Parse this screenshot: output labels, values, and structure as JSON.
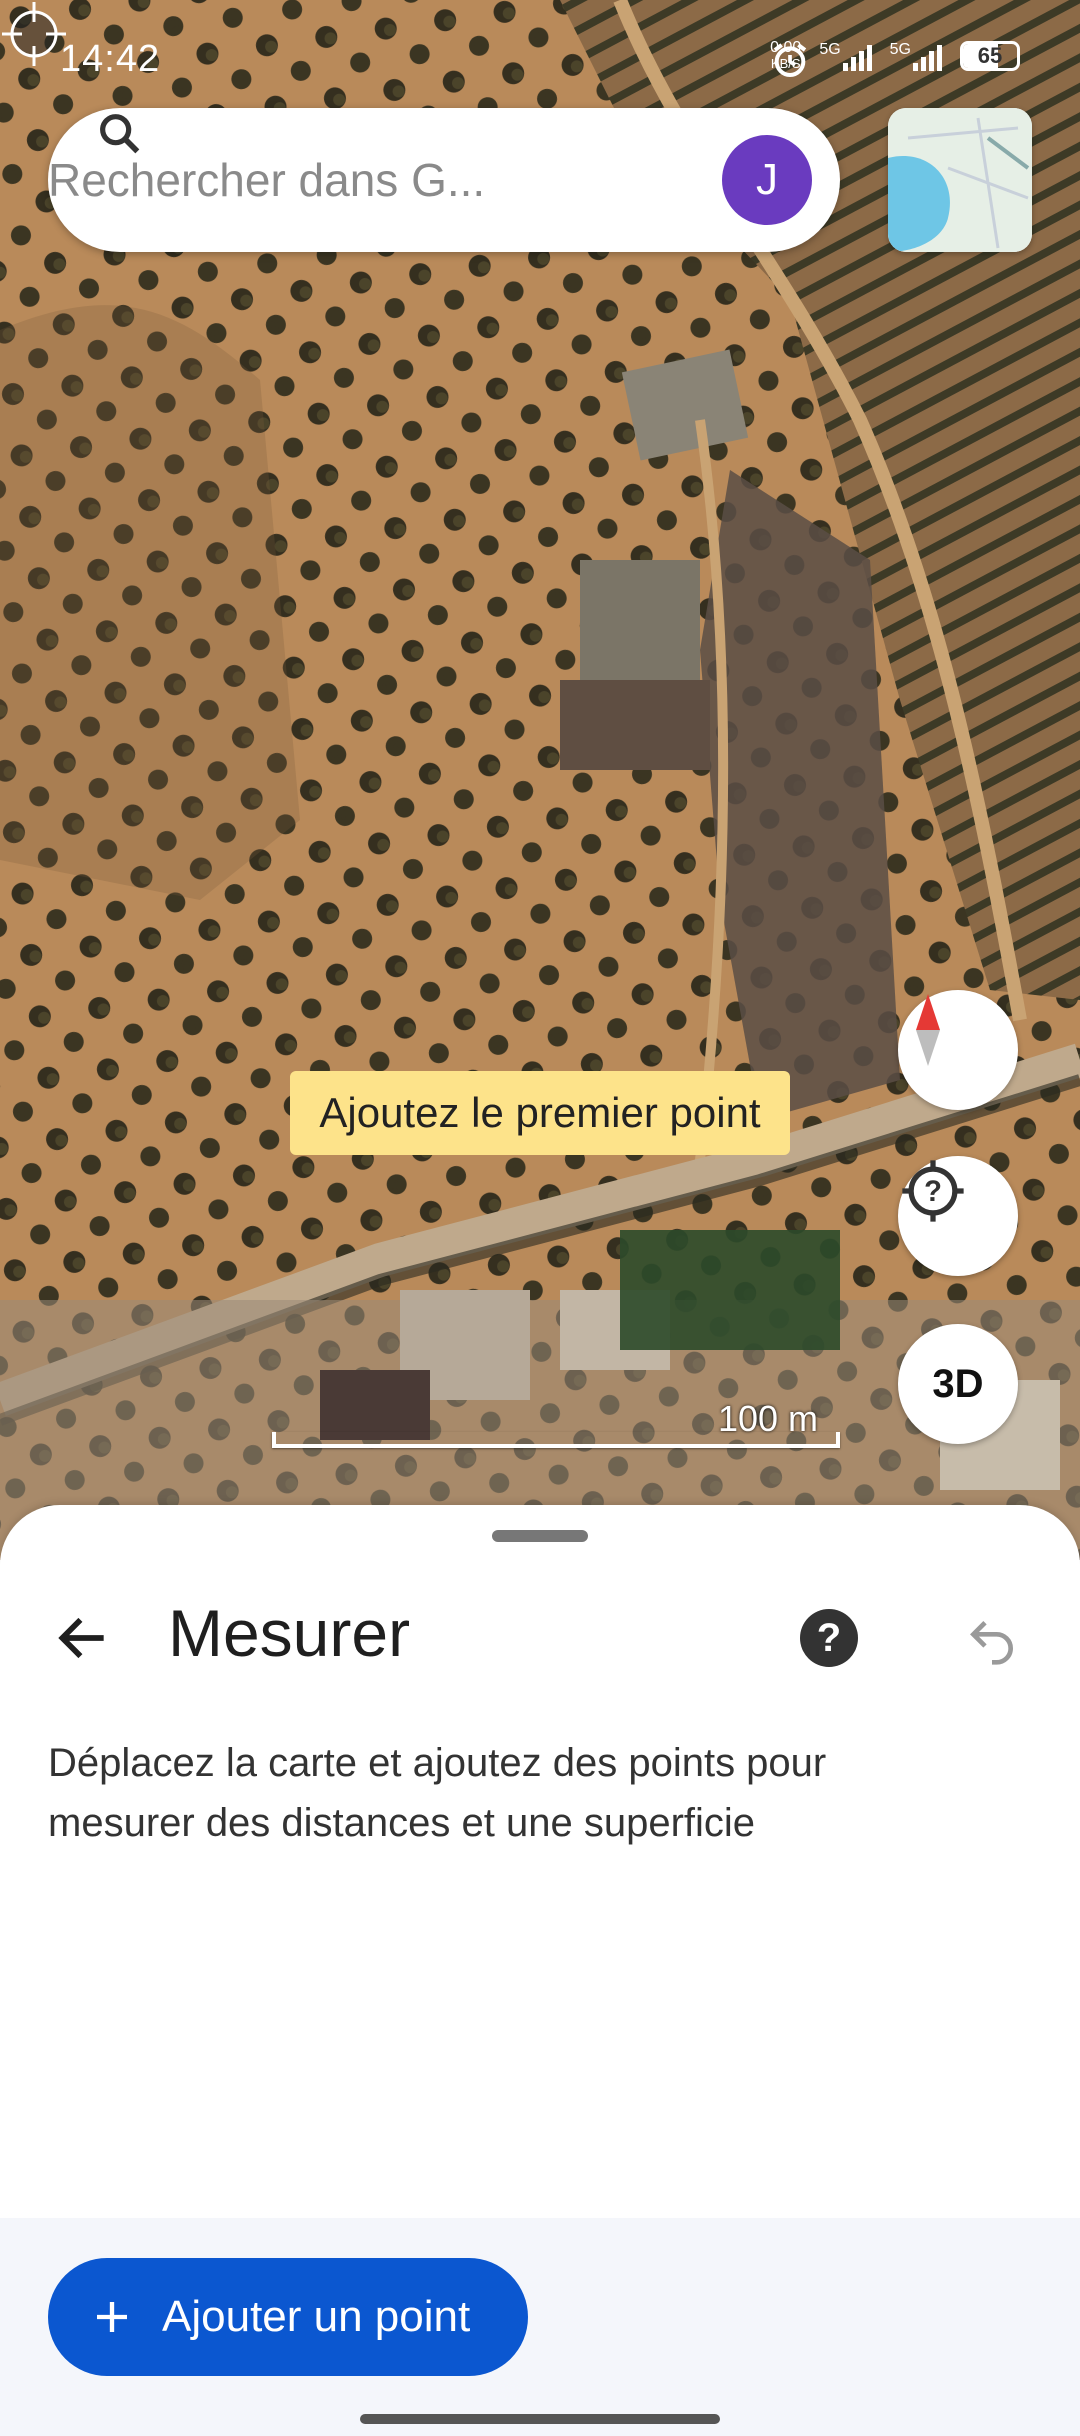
{
  "status_bar": {
    "time": "14:42",
    "net_speed": "0,00",
    "net_unit": "KB/S",
    "sim1": "5G",
    "sim2": "5G",
    "battery": "65"
  },
  "search": {
    "placeholder": "Rechercher dans G...",
    "avatar_letter": "J"
  },
  "map": {
    "hint": "Ajoutez le premier point",
    "scale_label": "100 m",
    "three_d_label": "3D"
  },
  "sheet": {
    "title": "Mesurer",
    "help_glyph": "?",
    "description": "Déplacez la carte et ajoutez des points pour mesurer des distances et une superficie",
    "add_button_label": "Ajouter un point"
  },
  "colors": {
    "accent": "#0b57d0",
    "hint_bg": "#fde38a",
    "avatar": "#6a3bbf"
  }
}
